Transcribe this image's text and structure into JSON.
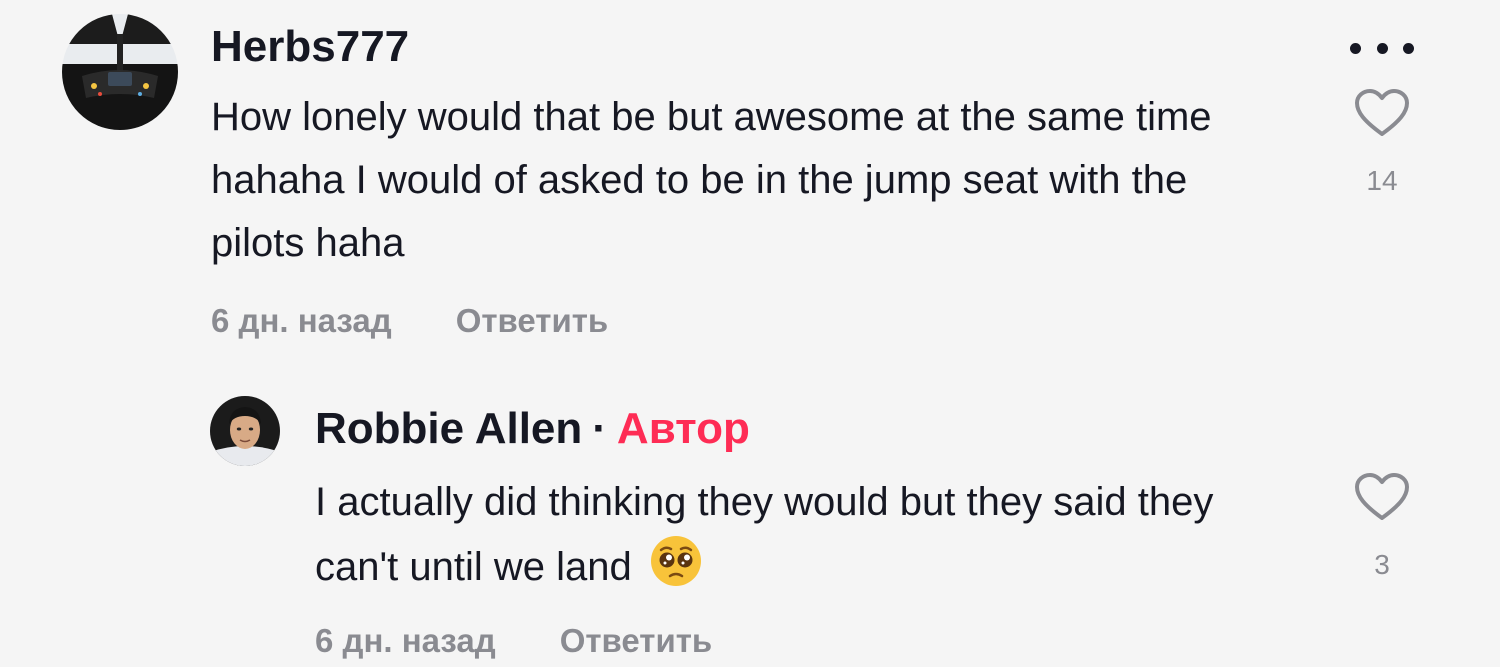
{
  "comments": [
    {
      "username": "Herbs777",
      "text": "How lonely would that be but awesome at the same time hahaha I would of asked to be in the jump seat with the pilots haha",
      "time": "6 дн. назад",
      "reply_label": "Ответить",
      "likes": "14"
    }
  ],
  "replies": [
    {
      "username": "Robbie Allen",
      "separator": "·",
      "author_badge": "Автор",
      "text": "I actually did thinking they would but they said they can't until we land",
      "emoji": "pleading-face-emoji",
      "time": "6 дн. назад",
      "reply_label": "Ответить",
      "likes": "3"
    }
  ],
  "icons": {
    "more": "more-options-icon",
    "like": "heart-outline-icon"
  },
  "colors": {
    "background": "#f5f5f5",
    "text": "#161823",
    "muted": "#8a8b91",
    "author": "#fe2c55"
  }
}
